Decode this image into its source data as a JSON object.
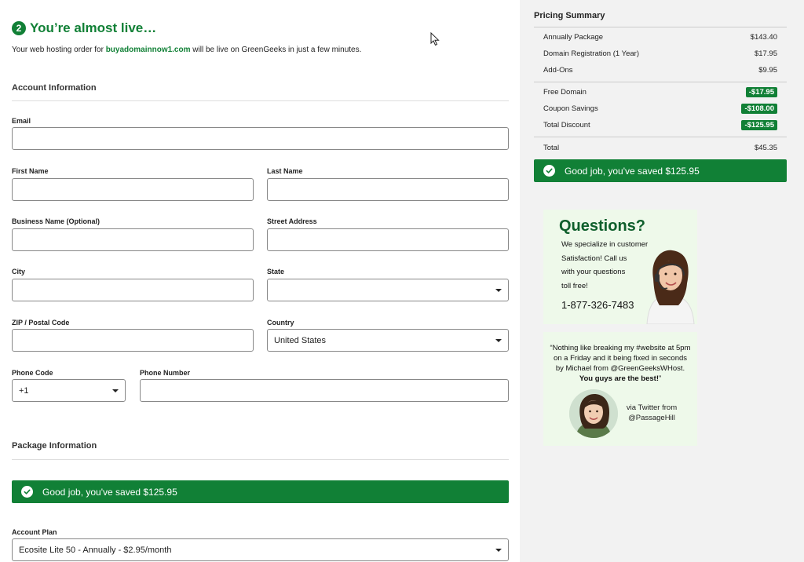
{
  "header": {
    "step_number": "2",
    "title": "You’re almost live…",
    "subtitle_prefix": "Your web hosting order for ",
    "subtitle_domain": "buyadomainnow1.com",
    "subtitle_suffix": " will be live on GreenGeeks in just a few minutes."
  },
  "account": {
    "section_title": "Account Information",
    "email_label": "Email",
    "email_value": "",
    "first_name_label": "First Name",
    "first_name_value": "",
    "last_name_label": "Last Name",
    "last_name_value": "",
    "business_label": "Business Name (Optional)",
    "business_value": "",
    "street_label": "Street Address",
    "street_value": "",
    "city_label": "City",
    "city_value": "",
    "state_label": "State",
    "state_value": "",
    "zip_label": "ZIP / Postal Code",
    "zip_value": "",
    "country_label": "Country",
    "country_value": "United States",
    "phone_code_label": "Phone Code",
    "phone_code_value": "+1",
    "phone_number_label": "Phone Number",
    "phone_number_value": ""
  },
  "package": {
    "section_title": "Package Information",
    "savings_text": "Good job, you've saved $125.95",
    "plan_label": "Account Plan",
    "plan_value": "Ecosite Lite 50 - Annually - $2.95/month"
  },
  "pricing": {
    "title": "Pricing Summary",
    "rows": [
      {
        "label": "Annually Package",
        "value": "$143.40"
      },
      {
        "label": "Domain Registration (1 Year)",
        "value": "$17.95"
      },
      {
        "label": "Add-Ons",
        "value": "$9.95"
      }
    ],
    "discounts": [
      {
        "label": "Free Domain",
        "value": "-$17.95"
      },
      {
        "label": "Coupon Savings",
        "value": "-$108.00"
      },
      {
        "label": "Total Discount",
        "value": "-$125.95"
      }
    ],
    "total_label": "Total",
    "total_value": "$45.35",
    "savings_text": "Good job, you've saved $125.95"
  },
  "questions": {
    "title": "Questions?",
    "line1": "We specialize in customer",
    "line2": "Satisfaction! Call us",
    "line3": "with your questions",
    "line4": "toll free!",
    "phone": "1-877-326-7483"
  },
  "testimonial": {
    "quote_line1": "“Nothing like breaking my #website at 5pm",
    "quote_line2": "on a Friday and it being fixed in seconds",
    "quote_line3": "by Michael from @GreenGeeksWHost.",
    "quote_bold": "You guys are the best!",
    "quote_end": "”",
    "via_line1": "via Twitter from",
    "via_line2": "@PassageHill"
  },
  "colors": {
    "brand_green": "#118036",
    "card_bg": "#eef9ea"
  }
}
